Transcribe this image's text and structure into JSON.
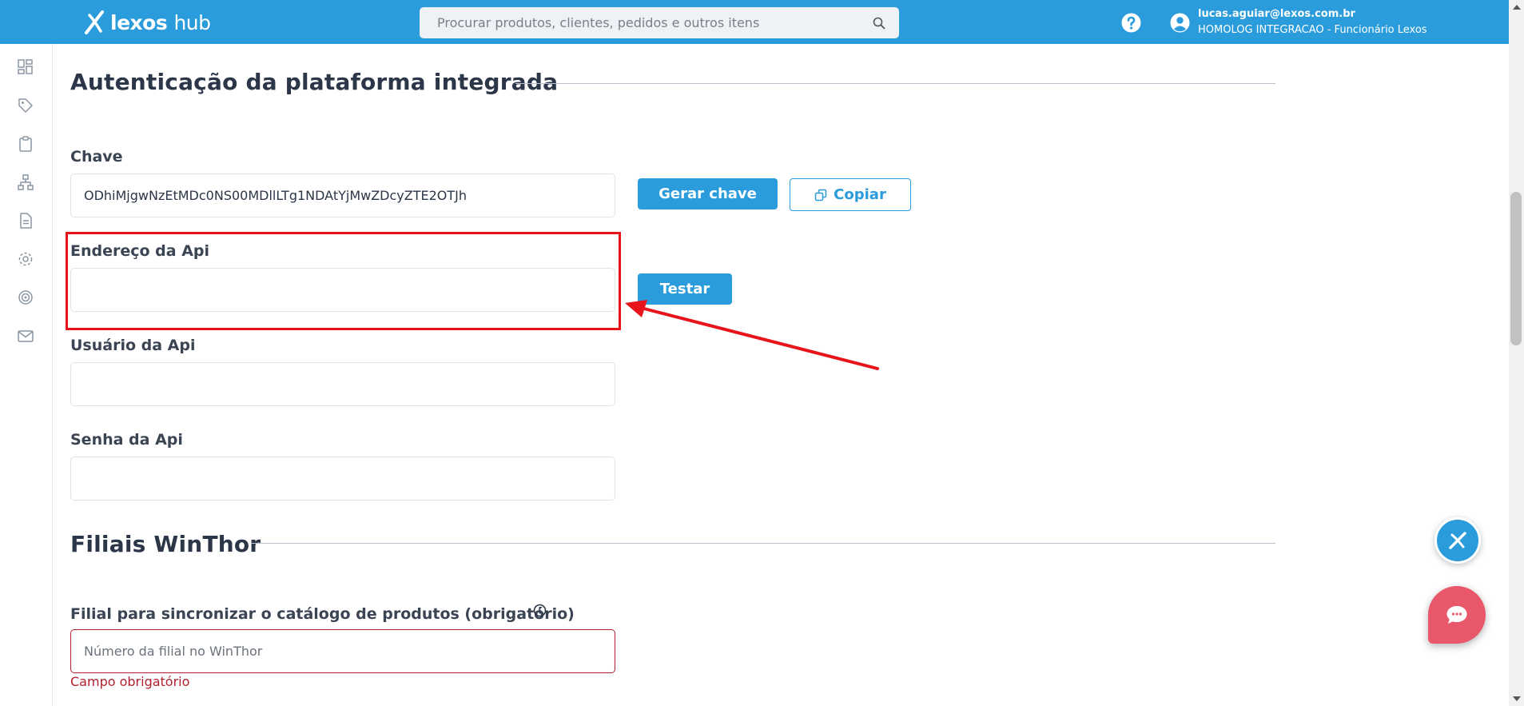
{
  "header": {
    "brand_name": "lexos",
    "brand_suffix": "hub",
    "search_placeholder": "Procurar produtos, clientes, pedidos e outros itens",
    "user_email": "lucas.aguiar@lexos.com.br",
    "user_org": "HOMOLOG INTEGRACAO - Funcionário Lexos"
  },
  "sidebar": {
    "icons": [
      "dashboard-icon",
      "tag-icon",
      "clipboard-icon",
      "network-icon",
      "document-icon",
      "settings-icon",
      "target-icon",
      "mail-icon"
    ]
  },
  "auth_section": {
    "title": "Autenticação da plataforma integrada",
    "key_label": "Chave",
    "key_value": "ODhiMjgwNzEtMDc0NS00MDllLTg1NDAtYjMwZDcyZTE2OTJh",
    "generate_key_label": "Gerar chave",
    "copy_label": "Copiar",
    "api_address_label": "Endereço da Api",
    "api_address_value": "",
    "test_label": "Testar",
    "api_user_label": "Usuário da Api",
    "api_user_value": "",
    "api_password_label": "Senha da Api",
    "api_password_value": ""
  },
  "branches_section": {
    "title": "Filiais WinThor",
    "catalog_branch_label": "Filial para sincronizar o catálogo de produtos (obrigatório)",
    "catalog_branch_placeholder": "Número da filial no WinThor",
    "required_error": "Campo obrigatório"
  },
  "colors": {
    "primary": "#2a9bdb",
    "error": "#b3202e",
    "annotation": "#e8141c",
    "chat": "#e8586a"
  }
}
